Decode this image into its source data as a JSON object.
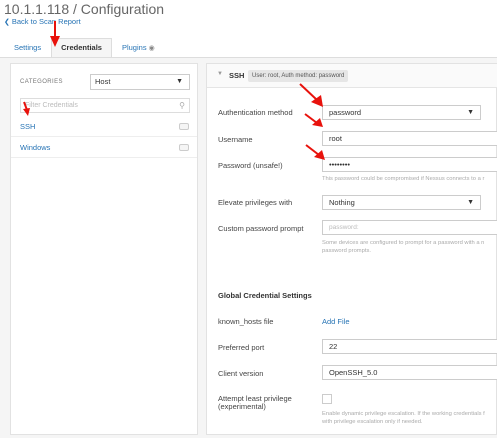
{
  "header": {
    "title": "10.1.1.118 / Configuration",
    "back_label": "Back to Scan Report",
    "back_icon": "chevron-left-icon"
  },
  "tabs": [
    {
      "label": "Settings",
      "active": false
    },
    {
      "label": "Credentials",
      "active": true
    },
    {
      "label": "Plugins",
      "active": false,
      "icon": "eye-icon"
    }
  ],
  "sidebar": {
    "categories_label": "CATEGORIES",
    "category_value": "Host",
    "filter_placeholder": "Filter Credentials",
    "items": [
      {
        "label": "SSH"
      },
      {
        "label": "Windows"
      }
    ]
  },
  "ssh": {
    "title": "SSH",
    "badge": "User: root, Auth method: password",
    "fields": {
      "auth_method_label": "Authentication method",
      "auth_method_value": "password",
      "username_label": "Username",
      "username_value": "root",
      "password_label": "Password (unsafe!)",
      "password_value": "••••••••",
      "password_help": "This password could be compromised if Nessus connects to a r",
      "elevate_label": "Elevate privileges with",
      "elevate_value": "Nothing",
      "custom_prompt_label": "Custom password prompt",
      "custom_prompt_placeholder": "password:",
      "custom_prompt_help_1": "Some devices are configured to prompt for a password with a n",
      "custom_prompt_help_2": "password prompts."
    }
  },
  "global": {
    "title": "Global Credential Settings",
    "known_hosts_label": "known_hosts file",
    "known_hosts_action": "Add File",
    "port_label": "Preferred port",
    "port_value": "22",
    "client_label": "Client version",
    "client_value": "OpenSSH_5.0",
    "least_priv_label_1": "Attempt least privilege",
    "least_priv_label_2": "(experimental)",
    "least_priv_help_1": "Enable dynamic privilege escalation. If the working credentials f",
    "least_priv_help_2": "with privilege escalation only if needed."
  },
  "colors": {
    "accent": "#2774b5",
    "annotation_arrow": "#e8120c",
    "panel_bg": "#f5f5f5"
  }
}
